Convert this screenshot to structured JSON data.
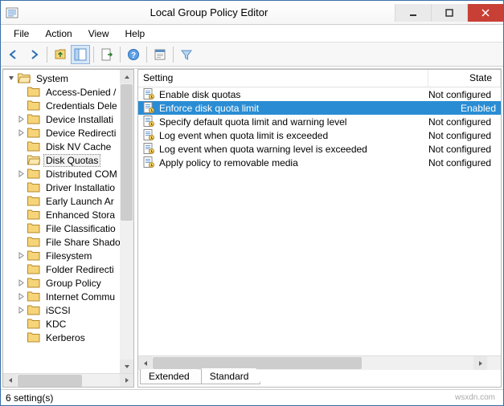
{
  "window": {
    "title": "Local Group Policy Editor"
  },
  "menu": {
    "file": "File",
    "action": "Action",
    "view": "View",
    "help": "Help"
  },
  "tree": {
    "root": "System",
    "items": [
      {
        "label": "Access-Denied /",
        "expandable": false
      },
      {
        "label": "Credentials Dele",
        "expandable": false
      },
      {
        "label": "Device Installati",
        "expandable": true
      },
      {
        "label": "Device Redirecti",
        "expandable": true
      },
      {
        "label": "Disk NV Cache",
        "expandable": false
      },
      {
        "label": "Disk Quotas",
        "expandable": false,
        "selected": true
      },
      {
        "label": "Distributed COM",
        "expandable": true
      },
      {
        "label": "Driver Installatio",
        "expandable": false
      },
      {
        "label": "Early Launch Ar",
        "expandable": false
      },
      {
        "label": "Enhanced Stora",
        "expandable": false
      },
      {
        "label": "File Classificatio",
        "expandable": false
      },
      {
        "label": "File Share Shado",
        "expandable": false
      },
      {
        "label": "Filesystem",
        "expandable": true
      },
      {
        "label": "Folder Redirecti",
        "expandable": false
      },
      {
        "label": "Group Policy",
        "expandable": true
      },
      {
        "label": "Internet Commu",
        "expandable": true
      },
      {
        "label": "iSCSI",
        "expandable": true
      },
      {
        "label": "KDC",
        "expandable": false
      },
      {
        "label": "Kerberos",
        "expandable": false
      }
    ]
  },
  "list": {
    "col_setting": "Setting",
    "col_state": "State",
    "rows": [
      {
        "setting": "Enable disk quotas",
        "state": "Not configured"
      },
      {
        "setting": "Enforce disk quota limit",
        "state": "Enabled",
        "selected": true
      },
      {
        "setting": "Specify default quota limit and warning level",
        "state": "Not configured"
      },
      {
        "setting": "Log event when quota limit is exceeded",
        "state": "Not configured"
      },
      {
        "setting": "Log event when quota warning level is exceeded",
        "state": "Not configured"
      },
      {
        "setting": "Apply policy to removable media",
        "state": "Not configured"
      }
    ]
  },
  "tabs": {
    "extended": "Extended",
    "standard": "Standard"
  },
  "status": {
    "text": "6 setting(s)"
  },
  "watermark": "wsxdn.com"
}
